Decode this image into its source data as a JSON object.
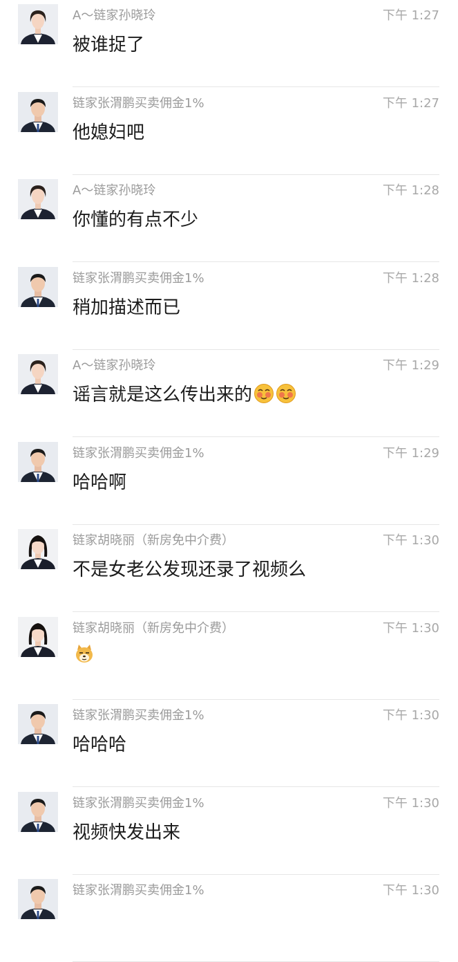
{
  "messages": [
    {
      "sender": "A～链家孙晓玲",
      "time": "下午 1:27",
      "text": "被谁捉了",
      "avatar": "female-agent-1",
      "emojis": []
    },
    {
      "sender": "链家张渭鹏买卖佣金1%",
      "time": "下午 1:27",
      "text": "他媳妇吧",
      "avatar": "male-agent",
      "emojis": []
    },
    {
      "sender": "A～链家孙晓玲",
      "time": "下午 1:28",
      "text": "你懂的有点不少",
      "avatar": "female-agent-1",
      "emojis": []
    },
    {
      "sender": "链家张渭鹏买卖佣金1%",
      "time": "下午 1:28",
      "text": "稍加描述而已",
      "avatar": "male-agent",
      "emojis": []
    },
    {
      "sender": "A～链家孙晓玲",
      "time": "下午 1:29",
      "text": "谣言就是这么传出来的",
      "avatar": "female-agent-1",
      "emojis": [
        "shy-face-emoji",
        "shy-face-emoji"
      ]
    },
    {
      "sender": "链家张渭鹏买卖佣金1%",
      "time": "下午 1:29",
      "text": "哈哈啊",
      "avatar": "male-agent",
      "emojis": []
    },
    {
      "sender": "链家胡晓丽（新房免中介费）",
      "time": "下午 1:30",
      "text": "不是女老公发现还录了视频么",
      "avatar": "female-agent-2",
      "emojis": []
    },
    {
      "sender": "链家胡晓丽（新房免中介费）",
      "time": "下午 1:30",
      "text": "",
      "avatar": "female-agent-2",
      "emojis": [
        "doge-emoji"
      ]
    },
    {
      "sender": "链家张渭鹏买卖佣金1%",
      "time": "下午 1:30",
      "text": "哈哈哈",
      "avatar": "male-agent",
      "emojis": []
    },
    {
      "sender": "链家张渭鹏买卖佣金1%",
      "time": "下午 1:30",
      "text": "视频快发出来",
      "avatar": "male-agent",
      "emojis": []
    },
    {
      "sender": "链家张渭鹏买卖佣金1%",
      "time": "下午 1:30",
      "text": "",
      "avatar": "male-agent",
      "emojis": []
    }
  ]
}
